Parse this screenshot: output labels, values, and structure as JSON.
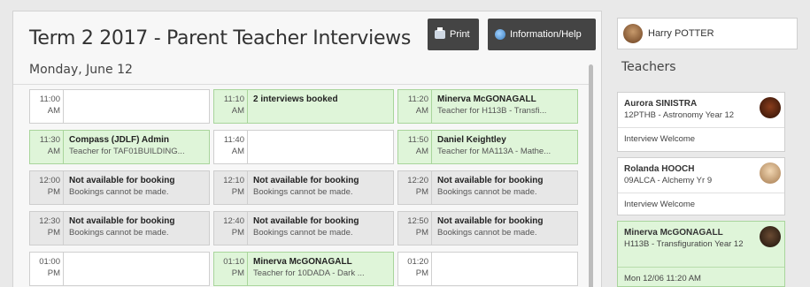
{
  "header": {
    "title": "Term 2 2017 - Parent Teacher Interviews",
    "print_label": "Print",
    "info_label": "Information/Help"
  },
  "date_label": "Monday, June 12",
  "rows": [
    [
      {
        "time": "11:00",
        "ampm": "AM",
        "state": "open",
        "title": "",
        "sub": ""
      },
      {
        "time": "11:10",
        "ampm": "AM",
        "state": "booked",
        "title": "2 interviews booked",
        "sub": ""
      },
      {
        "time": "11:20",
        "ampm": "AM",
        "state": "booked",
        "title": "Minerva McGONAGALL",
        "sub": "Teacher for H113B - Transfi..."
      }
    ],
    [
      {
        "time": "11:30",
        "ampm": "AM",
        "state": "booked",
        "title": "Compass (JDLF) Admin",
        "sub": "Teacher for TAF01BUILDING..."
      },
      {
        "time": "11:40",
        "ampm": "AM",
        "state": "open",
        "title": "",
        "sub": ""
      },
      {
        "time": "11:50",
        "ampm": "AM",
        "state": "booked",
        "title": "Daniel Keightley",
        "sub": "Teacher for MA113A - Mathe..."
      }
    ],
    [
      {
        "time": "12:00",
        "ampm": "PM",
        "state": "na",
        "title": "Not available for booking",
        "sub": "Bookings cannot be made."
      },
      {
        "time": "12:10",
        "ampm": "PM",
        "state": "na",
        "title": "Not available for booking",
        "sub": "Bookings cannot be made."
      },
      {
        "time": "12:20",
        "ampm": "PM",
        "state": "na",
        "title": "Not available for booking",
        "sub": "Bookings cannot be made."
      }
    ],
    [
      {
        "time": "12:30",
        "ampm": "PM",
        "state": "na",
        "title": "Not available for booking",
        "sub": "Bookings cannot be made."
      },
      {
        "time": "12:40",
        "ampm": "PM",
        "state": "na",
        "title": "Not available for booking",
        "sub": "Bookings cannot be made."
      },
      {
        "time": "12:50",
        "ampm": "PM",
        "state": "na",
        "title": "Not available for booking",
        "sub": "Bookings cannot be made."
      }
    ],
    [
      {
        "time": "01:00",
        "ampm": "PM",
        "state": "open",
        "title": "",
        "sub": ""
      },
      {
        "time": "01:10",
        "ampm": "PM",
        "state": "booked",
        "title": "Minerva McGONAGALL",
        "sub": "Teacher for 10DADA - Dark ..."
      },
      {
        "time": "01:20",
        "ampm": "PM",
        "state": "open",
        "title": "",
        "sub": ""
      }
    ]
  ],
  "sidebar": {
    "user_name": "Harry POTTER",
    "teachers_heading": "Teachers",
    "teachers": [
      {
        "name": "Aurora SINISTRA",
        "class": "12PTHB - Astronomy Year 12",
        "footer": "Interview Welcome"
      },
      {
        "name": "Rolanda HOOCH",
        "class": "09ALCA - Alchemy Yr 9",
        "footer": "Interview Welcome"
      },
      {
        "name": "Minerva McGONAGALL",
        "class": "H113B - Transfiguration Year 12",
        "footer": "Mon 12/06 11:20 AM"
      }
    ]
  },
  "colors": {
    "booked_bg": "#dff5d9",
    "unavailable_bg": "#e7e7e7",
    "toolbar_button_bg": "#444444"
  }
}
